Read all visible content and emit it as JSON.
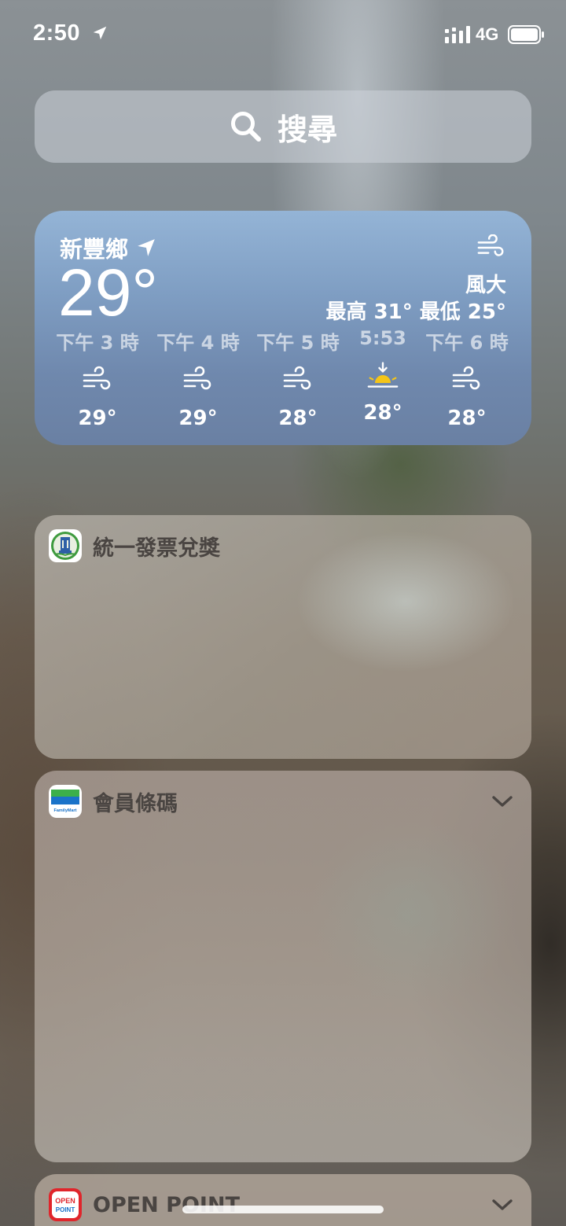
{
  "status_bar": {
    "time": "2:50",
    "network": "4G"
  },
  "search": {
    "label": "搜尋"
  },
  "weather": {
    "location": "新豐鄉",
    "current_temp": "29°",
    "condition": "風大",
    "high_low": "最高 31° 最低 25°",
    "hours": [
      {
        "label": "下午 3 時",
        "icon": "wind-icon",
        "temp": "29°"
      },
      {
        "label": "下午 4 時",
        "icon": "wind-icon",
        "temp": "29°"
      },
      {
        "label": "下午 5 時",
        "icon": "wind-icon",
        "temp": "28°"
      },
      {
        "label": "5:53",
        "icon": "sunset-icon",
        "temp": "28°"
      },
      {
        "label": "下午 6 時",
        "icon": "wind-icon",
        "temp": "28°"
      }
    ]
  },
  "widgets": {
    "invoice": {
      "title": "統一發票兌獎"
    },
    "member": {
      "title": "會員條碼",
      "icon_text": "FamilyMart"
    },
    "openpoint": {
      "title": "OPEN POINT",
      "icon_line1": "OPEN",
      "icon_line2": "POINT"
    }
  },
  "colors": {
    "weather_top": "#94b4d6",
    "weather_bottom": "#6a80a3",
    "sun": "#f5c518"
  }
}
